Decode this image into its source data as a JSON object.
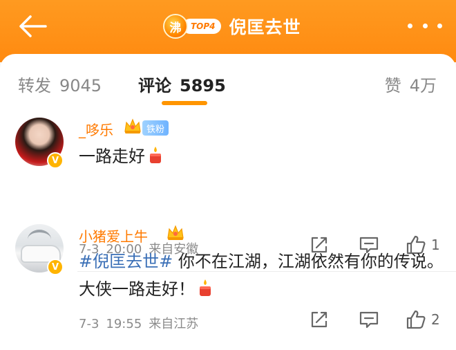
{
  "header": {
    "badge_char": "沸",
    "top_label": "TOP4",
    "title": "倪匡去世",
    "background_color": "#ff8f14"
  },
  "tabs": {
    "repost_label": "转发",
    "repost_count": "9045",
    "comments_label": "评论",
    "comments_count": "5895",
    "likes_label": "赞",
    "likes_count": "4万",
    "active_color": "#ff9500"
  },
  "comments": [
    {
      "username": "_哆乐",
      "fan_badge": "铁粉",
      "text": "一路走好",
      "date": "7-3",
      "time": "20:00",
      "source": "来自安徽",
      "like_count": "1"
    },
    {
      "username": "小猪爱上牛",
      "hashtag": "#倪匡去世#",
      "text": " 你不在江湖，江湖依然有你的传说。大侠一路走好！",
      "date": "7-3",
      "time": "19:55",
      "source": "来自江苏",
      "like_count": "2"
    }
  ],
  "icons": {
    "back": "back-arrow-icon",
    "more": "more-dots-icon",
    "verified": "verified-v-icon",
    "crown": "crown-icon",
    "candle": "candle-icon",
    "share": "share-icon",
    "reply": "comment-icon",
    "like": "thumbs-up-icon"
  }
}
